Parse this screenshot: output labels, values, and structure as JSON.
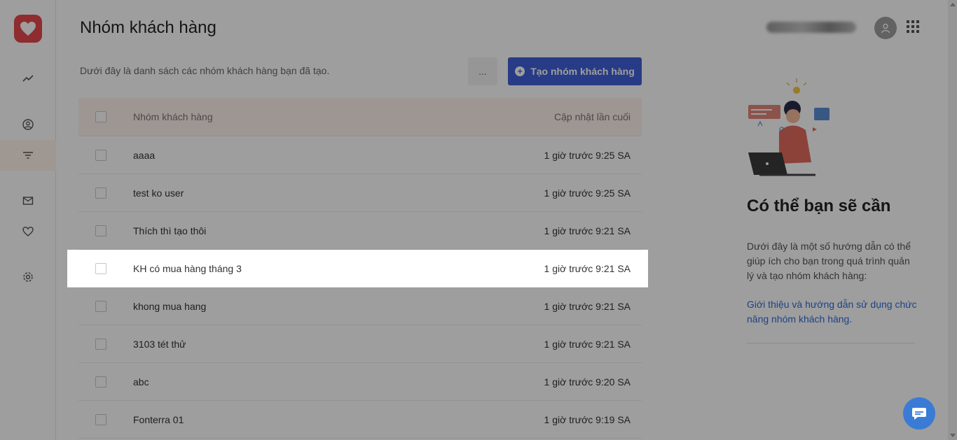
{
  "header": {
    "title": "Nhóm khách hàng"
  },
  "toolbar": {
    "subtitle": "Dưới đây là danh sách các nhóm khách hàng bạn đã tạo.",
    "more_label": "...",
    "create_label": "Tạo nhóm khách hàng"
  },
  "table": {
    "columns": {
      "name": "Nhóm khách hàng",
      "updated": "Cập nhật lần cuối"
    },
    "rows": [
      {
        "name": "aaaa",
        "updated": "1 giờ trước 9:25 SA"
      },
      {
        "name": "test ko user",
        "updated": "1 giờ trước 9:25 SA"
      },
      {
        "name": "Thích thì tạo thôi",
        "updated": "1 giờ trước 9:21 SA"
      },
      {
        "name": "KH có mua hàng tháng 3",
        "updated": "1 giờ trước 9:21 SA"
      },
      {
        "name": "khong mua hang",
        "updated": "1 giờ trước 9:21 SA"
      },
      {
        "name": "3103 tét thử",
        "updated": "1 giờ trước 9:21 SA"
      },
      {
        "name": "abc",
        "updated": "1 giờ trước 9:20 SA"
      },
      {
        "name": "Fonterra 01",
        "updated": "1 giờ trước 9:19 SA"
      }
    ]
  },
  "panel": {
    "title": "Có thể bạn sẽ cần",
    "description": "Dưới đây là một số hướng dẫn có thể giúp ích cho bạn trong quá trình quản lý và tạo nhóm khách hàng:",
    "link": "Giới thiệu và hướng dẫn sử dụng chức năng nhóm khách hàng."
  },
  "sidebar": {
    "items": [
      "analytics-icon",
      "contacts-icon",
      "filter-icon",
      "mail-icon",
      "heart-icon",
      "settings-icon"
    ],
    "active": "filter-icon"
  },
  "colors": {
    "primary": "#3f5fd8",
    "logo": "#e5484d",
    "link": "#2f6bd8",
    "highlight_row": "#ffffff"
  }
}
